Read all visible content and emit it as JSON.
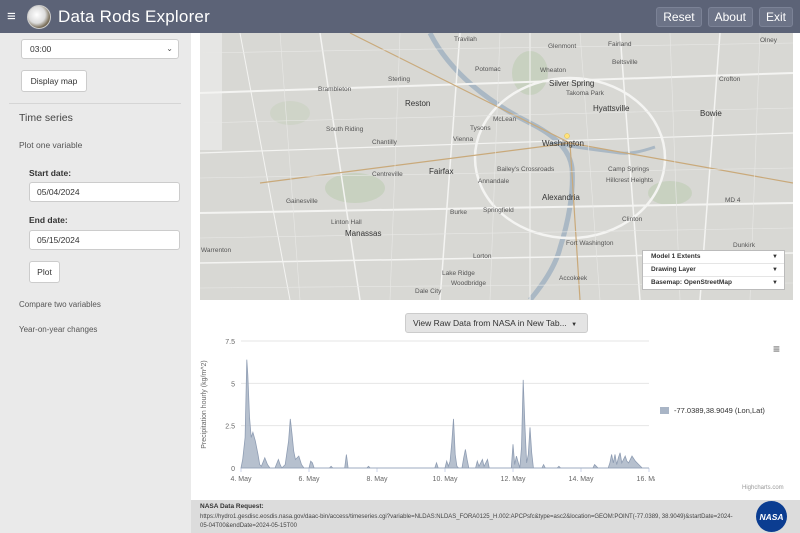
{
  "header": {
    "title": "Data Rods Explorer",
    "buttons": [
      "Reset",
      "About",
      "Exit"
    ]
  },
  "sidebar": {
    "time_select": "03:00",
    "display_map": "Display map",
    "section_title": "Time series",
    "plot_one": "Plot one variable",
    "start_label": "Start date:",
    "start_value": "05/04/2024",
    "end_label": "End date:",
    "end_value": "05/15/2024",
    "plot_button": "Plot",
    "compare": "Compare two variables",
    "yoy": "Year-on-year changes"
  },
  "map": {
    "labels": [
      "Travilah",
      "Glenmont",
      "Fairland",
      "Olney",
      "Potomac",
      "Silver Spring",
      "Wheaton",
      "Beltsville",
      "Takoma Park",
      "Crofton",
      "Brambleton",
      "Sterling",
      "Reston",
      "Hyattsville",
      "Bowie",
      "South Riding",
      "Chantilly",
      "Tysons",
      "McLean",
      "Vienna",
      "Washington",
      "Camp Springs",
      "Centreville",
      "Fairfax",
      "Annandale",
      "Bailey's Crossroads",
      "Alexandria",
      "Hillcrest Heights",
      "Gainesville",
      "Burke",
      "Springfield",
      "Clinton",
      "Linton Hall",
      "Manassas",
      "Fort Washington",
      "Warrenton",
      "Lorton",
      "Accokeek",
      "Lake Ridge",
      "Woodbridge",
      "Dale City",
      "Dunkirk",
      "MD 4"
    ],
    "layers": [
      {
        "label": "Model 1 Extents"
      },
      {
        "label": "Drawing Layer"
      },
      {
        "label": "Basemap: OpenStreetMap"
      }
    ]
  },
  "view_raw_button": "View Raw Data from NASA in New Tab...",
  "chart_data": {
    "type": "area",
    "ylabel": "Precipitation hourly (kg/m^2)",
    "ylim": [
      0,
      7.5
    ],
    "yticks": [
      "0",
      "2.5",
      "5",
      "7.5"
    ],
    "xticks": [
      "4. May",
      "6. May",
      "8. May",
      "10. May",
      "12. May",
      "14. May",
      "16. May"
    ],
    "x_start_day": 4,
    "x_end_day": 16,
    "series": [
      {
        "name": "-77.0389,38.9049 (Lon,Lat)",
        "color": "#a9b5c6",
        "points": [
          [
            4.0,
            0
          ],
          [
            4.05,
            0.5
          ],
          [
            4.12,
            1.8
          ],
          [
            4.17,
            6.4
          ],
          [
            4.2,
            5.5
          ],
          [
            4.25,
            3.0
          ],
          [
            4.3,
            1.8
          ],
          [
            4.35,
            2.1
          ],
          [
            4.42,
            1.6
          ],
          [
            4.5,
            0.8
          ],
          [
            4.55,
            0.2
          ],
          [
            4.6,
            0.1
          ],
          [
            4.7,
            0.6
          ],
          [
            4.78,
            0.2
          ],
          [
            4.85,
            0
          ],
          [
            5.0,
            0
          ],
          [
            5.1,
            0.5
          ],
          [
            5.15,
            0.2
          ],
          [
            5.2,
            0
          ],
          [
            5.3,
            0.2
          ],
          [
            5.4,
            1.6
          ],
          [
            5.45,
            2.9
          ],
          [
            5.5,
            2.0
          ],
          [
            5.55,
            1.0
          ],
          [
            5.6,
            0.5
          ],
          [
            5.7,
            0.7
          ],
          [
            5.78,
            0.2
          ],
          [
            5.85,
            0
          ],
          [
            6.0,
            0
          ],
          [
            6.05,
            0.4
          ],
          [
            6.1,
            0.3
          ],
          [
            6.15,
            0
          ],
          [
            6.6,
            0
          ],
          [
            6.65,
            0.1
          ],
          [
            6.7,
            0
          ],
          [
            7.05,
            0
          ],
          [
            7.1,
            0.8
          ],
          [
            7.15,
            0
          ],
          [
            7.7,
            0
          ],
          [
            7.75,
            0.1
          ],
          [
            7.8,
            0
          ],
          [
            9.7,
            0
          ],
          [
            9.75,
            0.3
          ],
          [
            9.8,
            0
          ],
          [
            10.0,
            0
          ],
          [
            10.05,
            0.4
          ],
          [
            10.1,
            0.1
          ],
          [
            10.15,
            0.4
          ],
          [
            10.2,
            1.5
          ],
          [
            10.25,
            2.9
          ],
          [
            10.3,
            0.8
          ],
          [
            10.35,
            0.1
          ],
          [
            10.4,
            0
          ],
          [
            10.5,
            0
          ],
          [
            10.55,
            0.6
          ],
          [
            10.6,
            1.1
          ],
          [
            10.65,
            0.5
          ],
          [
            10.7,
            0
          ],
          [
            10.9,
            0
          ],
          [
            10.95,
            0.4
          ],
          [
            11.0,
            0.1
          ],
          [
            11.1,
            0.5
          ],
          [
            11.15,
            0.1
          ],
          [
            11.2,
            0.3
          ],
          [
            11.25,
            0.5
          ],
          [
            11.3,
            0
          ],
          [
            11.95,
            0
          ],
          [
            12.0,
            1.4
          ],
          [
            12.05,
            0.2
          ],
          [
            12.1,
            0.7
          ],
          [
            12.2,
            0
          ],
          [
            12.25,
            1.2
          ],
          [
            12.3,
            5.2
          ],
          [
            12.35,
            2.5
          ],
          [
            12.4,
            0.3
          ],
          [
            12.45,
            0.8
          ],
          [
            12.5,
            2.4
          ],
          [
            12.55,
            0.9
          ],
          [
            12.6,
            0
          ],
          [
            12.85,
            0
          ],
          [
            12.9,
            0.2
          ],
          [
            12.95,
            0
          ],
          [
            13.3,
            0
          ],
          [
            13.35,
            0.1
          ],
          [
            13.4,
            0
          ],
          [
            14.35,
            0
          ],
          [
            14.4,
            0.2
          ],
          [
            14.45,
            0.1
          ],
          [
            14.5,
            0
          ],
          [
            14.8,
            0
          ],
          [
            14.85,
            0.3
          ],
          [
            14.9,
            0.8
          ],
          [
            14.95,
            0.3
          ],
          [
            15.0,
            0.8
          ],
          [
            15.05,
            0.2
          ],
          [
            15.1,
            0.6
          ],
          [
            15.15,
            0.9
          ],
          [
            15.2,
            0.3
          ],
          [
            15.3,
            0.7
          ],
          [
            15.35,
            0.4
          ],
          [
            15.4,
            0.3
          ],
          [
            15.5,
            0.7
          ],
          [
            15.6,
            0.4
          ],
          [
            15.7,
            0.2
          ],
          [
            15.8,
            0
          ],
          [
            16.0,
            0
          ]
        ]
      }
    ]
  },
  "chart_menu": "≡",
  "credits": "Highcharts.com",
  "footer": {
    "title": "NASA Data Request:",
    "url": "https://hydro1.gesdisc.eosdis.nasa.gov/daac-bin/access/timeseries.cgi?variable=NLDAS:NLDAS_FORA0125_H.002:APCPsfc&type=asc2&location=GEOM:POINT(-77.0389, 38.9049)&startDate=2024-05-04T00&endDate=2024-05-15T00",
    "logo_text": "NASA"
  }
}
